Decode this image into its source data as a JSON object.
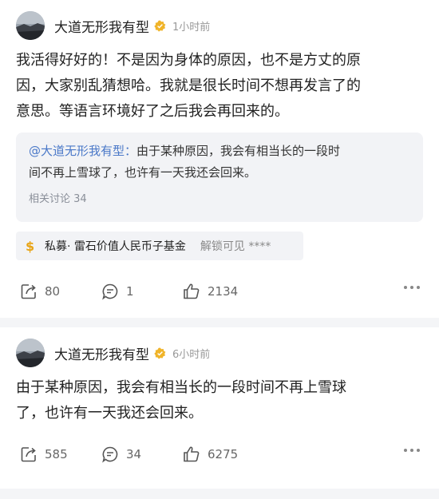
{
  "posts": [
    {
      "author": "大道无形我有型",
      "time": "1小时前",
      "body_lines": [
        "我活得好好的！不是因为身体的原因，也不是方丈的原",
        "因，大家别乱猜想哈。我就是很长时间不想再发言了的",
        "意思。等语言环境好了之后我会再回来的。"
      ],
      "quote": {
        "user": "@大道无形我有型：",
        "text_line1": "由于某种原因，我会有相当长的一段时",
        "text_line2": "间不再上雪球了，也许有一天我还会回来。",
        "meta": "相关讨论 34"
      },
      "fund": {
        "icon": "$",
        "name": "私募· 雷石价值人民币子基金",
        "lock_text": "解锁可见 ****"
      },
      "actions": {
        "repost": "80",
        "comment": "1",
        "like": "2134"
      }
    },
    {
      "author": "大道无形我有型",
      "time": "6小时前",
      "body_lines": [
        "由于某种原因，我会有相当长的一段时间不再上雪球",
        "了，也许有一天我还会回来。"
      ],
      "actions": {
        "repost": "585",
        "comment": "34",
        "like": "6275"
      }
    }
  ],
  "colors": {
    "accent_link": "#4a78c8",
    "badge": "#f0b429",
    "fund_icon": "#e8a416"
  },
  "icons": [
    "repost-icon",
    "comment-icon",
    "like-icon",
    "more-icon",
    "verified-badge-icon"
  ]
}
